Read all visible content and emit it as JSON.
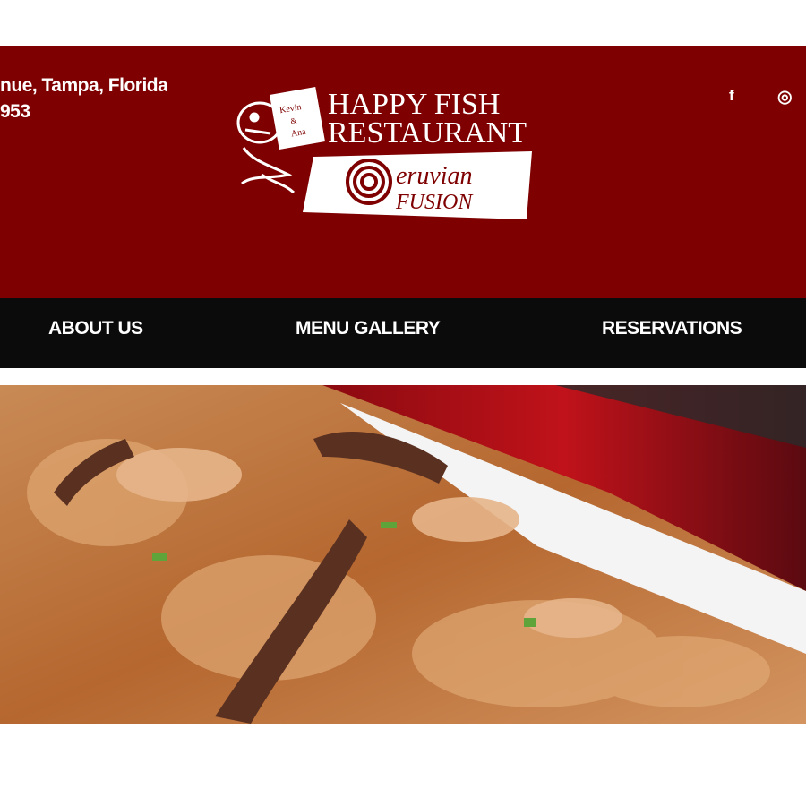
{
  "header": {
    "address_line1": "nue, Tampa, Florida",
    "address_line2": "953",
    "social": {
      "facebook": "f",
      "instagram": "◎"
    },
    "logo": {
      "line1": "HAPPY FISH",
      "line2": "RESTAURANT",
      "book_text": "Kevin & Ana",
      "tagline_part1": "eruvian",
      "tagline_part2": "FUSION"
    }
  },
  "nav": {
    "items": [
      {
        "label": "ABOUT US"
      },
      {
        "label": "MENU GALLERY"
      },
      {
        "label": "RESERVATIONS"
      }
    ]
  },
  "colors": {
    "header_bg": "#7f0000",
    "nav_bg": "#0b0b0b",
    "text": "#ffffff"
  }
}
